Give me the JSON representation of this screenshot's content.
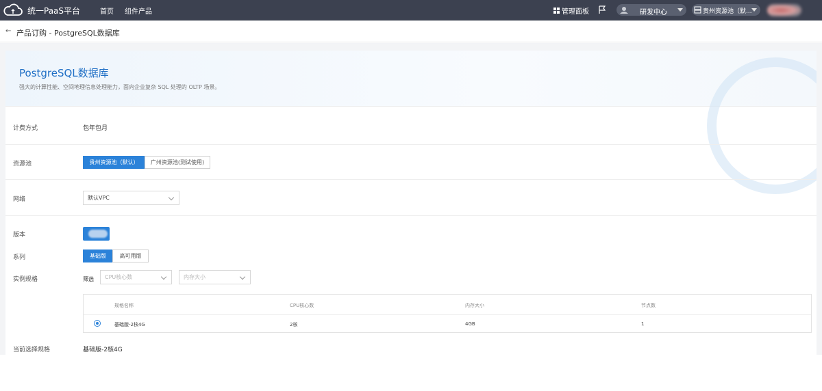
{
  "topbar": {
    "brand": "统一PaaS平台",
    "nav": [
      "首页",
      "组件产品"
    ],
    "dashboard_label": "管理面板",
    "org_label": "研发中心",
    "pool_label": "贵州资源池（默..."
  },
  "breadcrumb": {
    "text": "产品订购 - PostgreSQL数据库",
    "back_icon": "←"
  },
  "hero": {
    "title": "PostgreSQL数据库",
    "subtitle": "强大的计算性能、空间地理信息处理能力，面向企业复杂 SQL 处理的 OLTP 场景。"
  },
  "form": {
    "billing": {
      "label": "计费方式",
      "value": "包年包月"
    },
    "pool": {
      "label": "资源池",
      "options": [
        "贵州资源池（默认）",
        "广州资源池(测试使用)"
      ],
      "selected": 0
    },
    "network": {
      "label": "网络",
      "value": "默认VPC"
    },
    "version": {
      "label": "版本"
    },
    "series": {
      "label": "系列",
      "options": [
        "基础版",
        "高可用版"
      ],
      "selected": 0
    },
    "spec": {
      "label": "实例规格",
      "filter_label": "筛选",
      "cpu_placeholder": "CPU核心数",
      "mem_placeholder": "内存大小"
    },
    "table": {
      "headers": [
        "规格名称",
        "CPU核心数",
        "内存大小",
        "节点数"
      ],
      "rows": [
        [
          "基础版-2核4G",
          "2核",
          "4GB",
          "1"
        ]
      ]
    },
    "current": {
      "label": "当前选择规格",
      "value": "基础版-2核4G"
    }
  },
  "colors": {
    "topbar": "#3c4150",
    "accent": "#2b82d9",
    "title": "#1f6fc5"
  }
}
